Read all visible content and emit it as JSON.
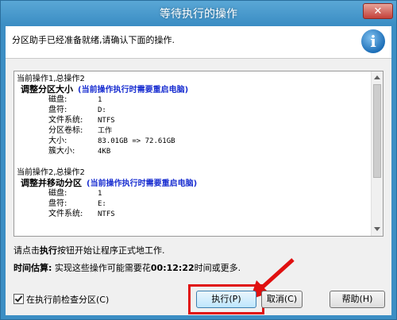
{
  "window": {
    "title": "等待执行的操作",
    "close_label": "✕"
  },
  "header": {
    "text": "分区助手已经准备就绪,请确认下面的操作.",
    "icon": "info-icon",
    "icon_glyph": "i"
  },
  "operations": [
    {
      "header": "当前操作1,总操作2",
      "title": "调整分区大小",
      "note": "(当前操作执行时需要重启电脑)",
      "fields": [
        {
          "k": "磁盘:",
          "v": "1"
        },
        {
          "k": "盘符:",
          "v": "D:"
        },
        {
          "k": "文件系统:",
          "v": "NTFS"
        },
        {
          "k": "分区卷标:",
          "v": "工作"
        },
        {
          "k": "大小:",
          "v": "83.01GB => 72.61GB"
        },
        {
          "k": "簇大小:",
          "v": "4KB"
        }
      ]
    },
    {
      "header": "当前操作2,总操作2",
      "title": "调整并移动分区",
      "note": "(当前操作执行时需要重启电脑)",
      "fields": [
        {
          "k": "磁盘:",
          "v": "1"
        },
        {
          "k": "盘符:",
          "v": "E:"
        },
        {
          "k": "文件系统:",
          "v": "NTFS"
        }
      ]
    }
  ],
  "hint": {
    "prefix": "请点击",
    "bold": "执行",
    "suffix": "按钮开始让程序正式地工作."
  },
  "estimate": {
    "label": "时间估算:",
    "prefix": " 实现这些操作可能需要花",
    "time": "00:12:22",
    "suffix": "时间或更多."
  },
  "checkbox": {
    "label": "在执行前检查分区(C)",
    "checked": true
  },
  "buttons": {
    "execute": "执行(P)",
    "cancel": "取消(C)",
    "help": "帮助(H)"
  },
  "colors": {
    "title_bar": "#3c8ec4",
    "note_text": "#1a2fd1",
    "highlight": "#e01010"
  }
}
